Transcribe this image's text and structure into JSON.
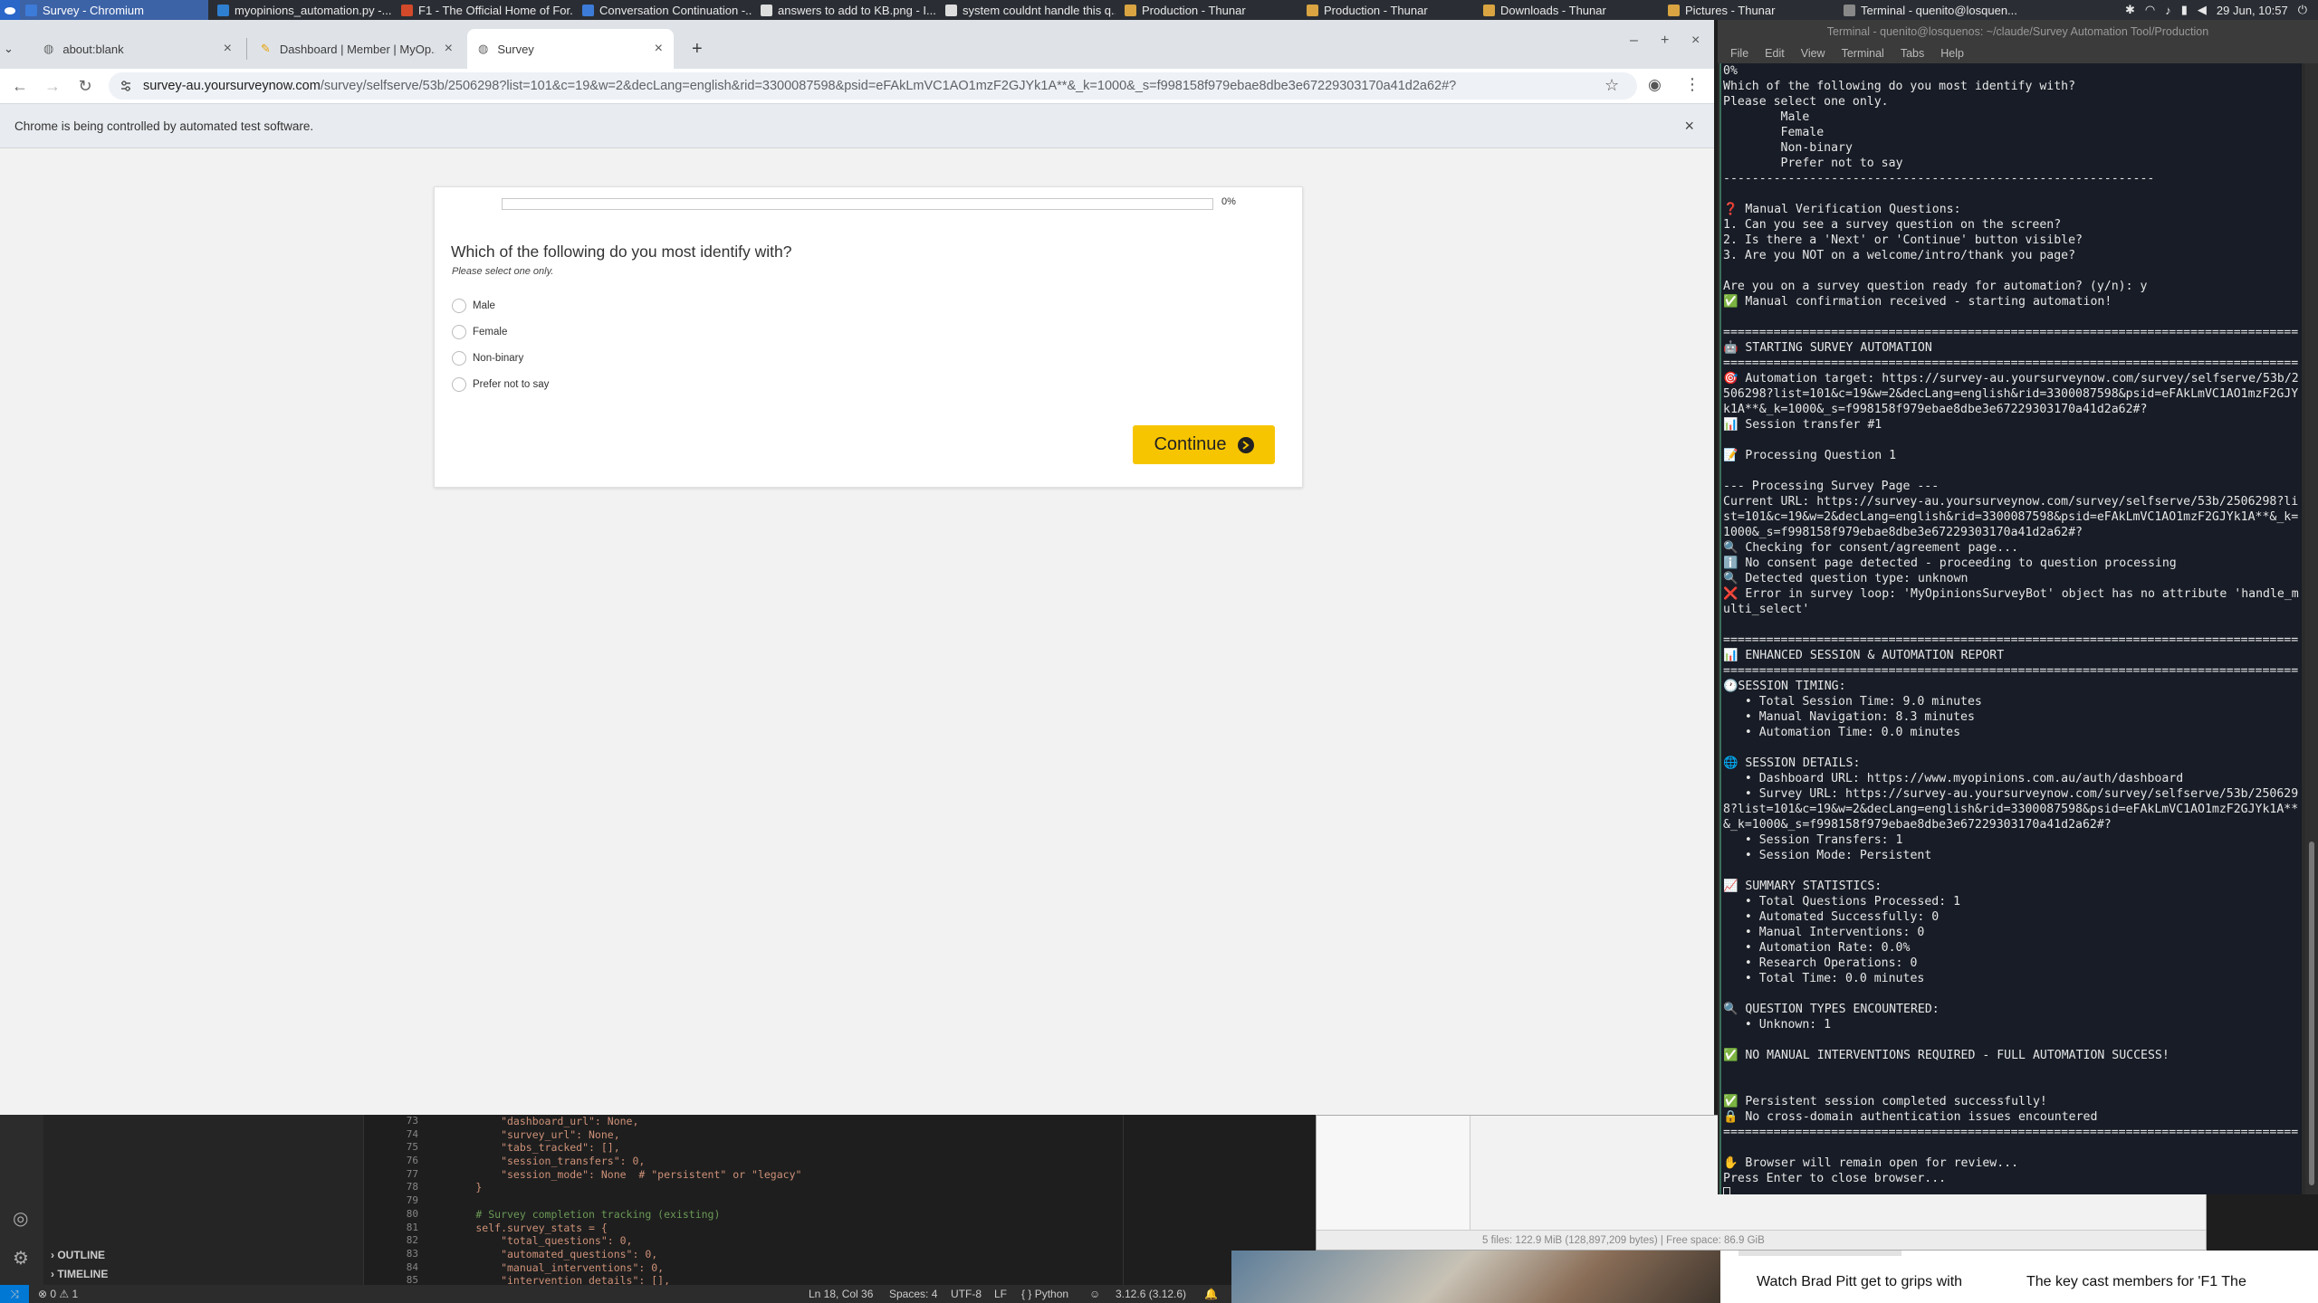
{
  "taskbar": {
    "items": [
      {
        "label": "Survey - Chromium",
        "active": true
      },
      {
        "label": "myopinions_automation.py -..."
      },
      {
        "label": "F1 - The Official Home of For..."
      },
      {
        "label": "Conversation Continuation -..."
      },
      {
        "label": "answers to add to KB.png - I..."
      },
      {
        "label": "system couldnt handle this q..."
      },
      {
        "label": "Production - Thunar"
      },
      {
        "label": "Production - Thunar"
      },
      {
        "label": "Downloads - Thunar"
      },
      {
        "label": "Pictures - Thunar"
      },
      {
        "label": "Terminal - quenito@losquen..."
      }
    ],
    "clock": "29 Jun, 10:57"
  },
  "browser": {
    "tabs": [
      {
        "label": "about:blank"
      },
      {
        "label": "Dashboard | Member | MyOp..."
      },
      {
        "label": "Survey",
        "active": true
      }
    ],
    "new_tab_label": "+",
    "url_host": "survey-au.yoursurveynow.com",
    "url_path": "/survey/selfserve/53b/2506298?list=101&c=19&w=2&decLang=english&rid=3300087598&psid=eFAkLmVC1AO1mzF2GJYk1A**&_k=1000&_s=f998158f979ebae8dbe3e67229303170a41d2a62#?",
    "infobar_text": "Chrome is being controlled by automated test software.",
    "infobar_close": "×"
  },
  "survey": {
    "progress_text": "0%",
    "progress_value": 0,
    "question": "Which of the following do you most identify with?",
    "instruction": "Please select one only.",
    "options": [
      "Male",
      "Female",
      "Non-binary",
      "Prefer not to say"
    ],
    "continue_label": "Continue",
    "accent_color": "#f7c500"
  },
  "terminal": {
    "title": "Terminal - quenito@losquenos: ~/claude/Survey Automation Tool/Production",
    "menu": [
      "File",
      "Edit",
      "View",
      "Terminal",
      "Tabs",
      "Help"
    ],
    "lines": [
      "0%",
      "Which of the following do you most identify with?",
      "Please select one only.",
      "        Male",
      "        Female",
      "        Non-binary",
      "        Prefer not to say",
      "------------------------------------------------------------",
      "",
      "❓ Manual Verification Questions:",
      "1. Can you see a survey question on the screen?",
      "2. Is there a 'Next' or 'Continue' button visible?",
      "3. Are you NOT on a welcome/intro/thank you page?",
      "",
      "Are you on a survey question ready for automation? (y/n): y",
      "✅ Manual confirmation received - starting automation!",
      "",
      "================================================================================",
      "🤖 STARTING SURVEY AUTOMATION",
      "================================================================================",
      "🎯 Automation target: https://survey-au.yoursurveynow.com/survey/selfserve/53b/2506298?list=101&c=19&w=2&decLang=english&rid=3300087598&psid=eFAkLmVC1AO1mzF2GJYk1A**&_k=1000&_s=f998158f979ebae8dbe3e67229303170a41d2a62#?",
      "📊 Session transfer #1",
      "",
      "📝 Processing Question 1",
      "",
      "--- Processing Survey Page ---",
      "Current URL: https://survey-au.yoursurveynow.com/survey/selfserve/53b/2506298?list=101&c=19&w=2&decLang=english&rid=3300087598&psid=eFAkLmVC1AO1mzF2GJYk1A**&_k=1000&_s=f998158f979ebae8dbe3e67229303170a41d2a62#?",
      "🔍 Checking for consent/agreement page...",
      "ℹ️ No consent page detected - proceeding to question processing",
      "🔍 Detected question type: unknown",
      "❌ Error in survey loop: 'MyOpinionsSurveyBot' object has no attribute 'handle_multi_select'",
      "",
      "================================================================================",
      "📊 ENHANCED SESSION & AUTOMATION REPORT",
      "================================================================================",
      "🕐SESSION TIMING:",
      "   • Total Session Time: 9.0 minutes",
      "   • Manual Navigation: 8.3 minutes",
      "   • Automation Time: 0.0 minutes",
      "",
      "🌐 SESSION DETAILS:",
      "   • Dashboard URL: https://www.myopinions.com.au/auth/dashboard",
      "   • Survey URL: https://survey-au.yoursurveynow.com/survey/selfserve/53b/2506298?list=101&c=19&w=2&decLang=english&rid=3300087598&psid=eFAkLmVC1AO1mzF2GJYk1A**&_k=1000&_s=f998158f979ebae8dbe3e67229303170a41d2a62#?",
      "   • Session Transfers: 1",
      "   • Session Mode: Persistent",
      "",
      "📈 SUMMARY STATISTICS:",
      "   • Total Questions Processed: 1",
      "   • Automated Successfully: 0",
      "   • Manual Interventions: 0",
      "   • Automation Rate: 0.0%",
      "   • Research Operations: 0",
      "   • Total Time: 0.0 minutes",
      "",
      "🔍 QUESTION TYPES ENCOUNTERED:",
      "   • Unknown: 1",
      "",
      "✅ NO MANUAL INTERVENTIONS REQUIRED - FULL AUTOMATION SUCCESS!",
      "",
      "",
      "✅ Persistent session completed successfully!",
      "🔒 No cross-domain authentication issues encountered",
      "================================================================================",
      "",
      "✋ Browser will remain open for review...",
      "Press Enter to close browser..."
    ]
  },
  "vscode": {
    "sections": [
      "OUTLINE",
      "TIMELINE"
    ],
    "line_numbers": [
      "73",
      "74",
      "75",
      "76",
      "77",
      "78",
      "79",
      "80",
      "81",
      "82",
      "83",
      "84",
      "85"
    ],
    "code_lines": [
      "            \"dashboard_url\": None,",
      "            \"survey_url\": None,",
      "            \"tabs_tracked\": [],",
      "            \"session_transfers\": 0,",
      "            \"session_mode\": None  # \"persistent\" or \"legacy\"",
      "        }",
      "",
      "        # Survey completion tracking (existing)",
      "        self.survey_stats = {",
      "            \"total_questions\": 0,",
      "            \"automated_questions\": 0,",
      "            \"manual_interventions\": 0,",
      "            \"intervention_details\": [],"
    ],
    "status": {
      "problems": "0",
      "warnings": "1",
      "position": "Ln 18, Col 36",
      "spaces": "Spaces: 4",
      "encoding": "UTF-8",
      "eol": "LF",
      "language": "Python",
      "interpreter": "3.12.6 (3.12.6)"
    }
  },
  "thunar": {
    "status": "5 files: 122.9 MiB (128,897,209 bytes)  |  Free space: 86.9 GiB"
  },
  "news": {
    "captions": [
      "Watch Brad Pitt get to grips with",
      "The key cast members for 'F1 The"
    ]
  }
}
